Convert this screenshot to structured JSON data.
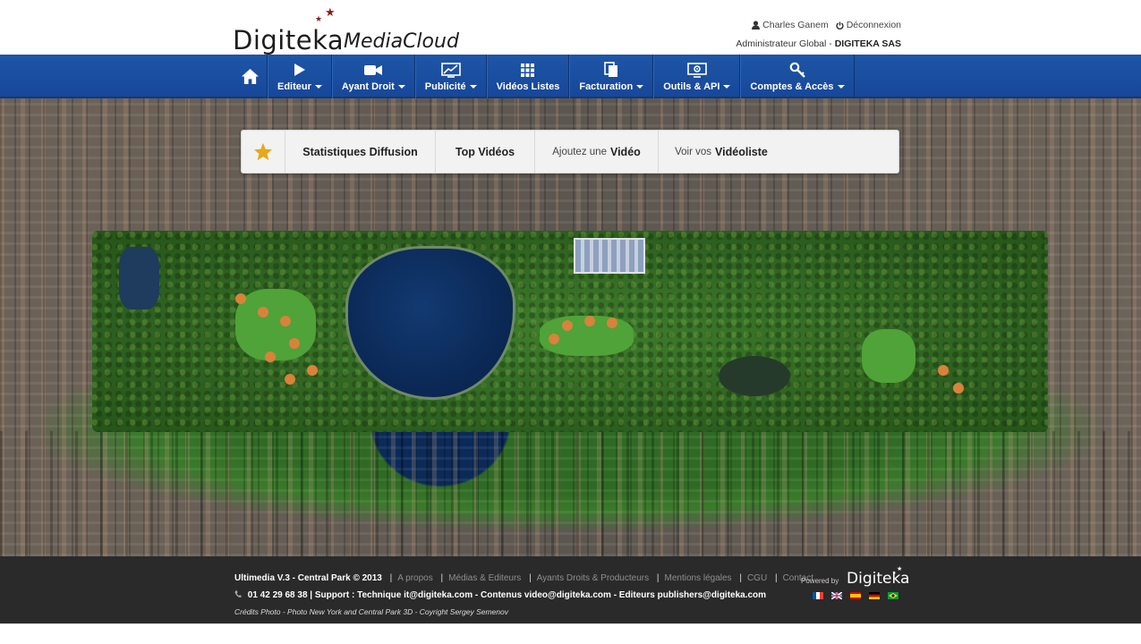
{
  "header": {
    "brand": "Digiteka",
    "product": "MediaCloud",
    "user_name": "Charles Ganem",
    "logout": "Déconnexion",
    "role": "Administrateur Global",
    "company": "DIGITEKA SAS"
  },
  "nav": {
    "items": [
      {
        "label": "Editeur",
        "icon": "play-icon"
      },
      {
        "label": "Ayant Droit",
        "icon": "video-camera-icon"
      },
      {
        "label": "Publicité",
        "icon": "chart-screen-icon"
      },
      {
        "label": "Vidéos Listes",
        "icon": "grid-icon"
      },
      {
        "label": "Facturation",
        "icon": "documents-icon"
      },
      {
        "label": "Outils & API",
        "icon": "monitor-gear-icon"
      },
      {
        "label": "Comptes & Accès",
        "icon": "key-icon"
      }
    ]
  },
  "quickbar": {
    "stats": "Statistiques Diffusion",
    "top": "Top Vidéos",
    "add_prefix": "Ajoutez une",
    "add_strong": "Vidéo",
    "view_prefix": "Voir vos",
    "view_strong": "Vidéoliste"
  },
  "footer": {
    "version": "Ultimedia V.3 - Central Park © 2013",
    "links": [
      "A propos",
      "Médias & Editeurs",
      "Ayants Droits & Producteurs",
      "Mentions légales",
      "CGU",
      "Contact"
    ],
    "phone": "01 42 29 68 38",
    "support": "| Support : Technique",
    "tech_email": "it@digiteka.com",
    "contenus": "- Contenus",
    "contenus_email": "video@digiteka.com",
    "editeurs": "- Editeurs",
    "editeurs_email": "publishers@digiteka.com",
    "credits": "Crédits Photo - Photo New York and Central Park 3D - Coyright Sergey Semenov",
    "powered_by": "Powered by",
    "powered_brand": "Digiteka",
    "flags": [
      "fr-flag",
      "uk-flag",
      "es-flag",
      "de-flag",
      "br-flag"
    ]
  },
  "colors": {
    "nav_blue": "#1b50a0",
    "footer_bg": "#2a2a2a",
    "star_gold": "#e8a81a",
    "logo_star": "#8b1a1a"
  }
}
